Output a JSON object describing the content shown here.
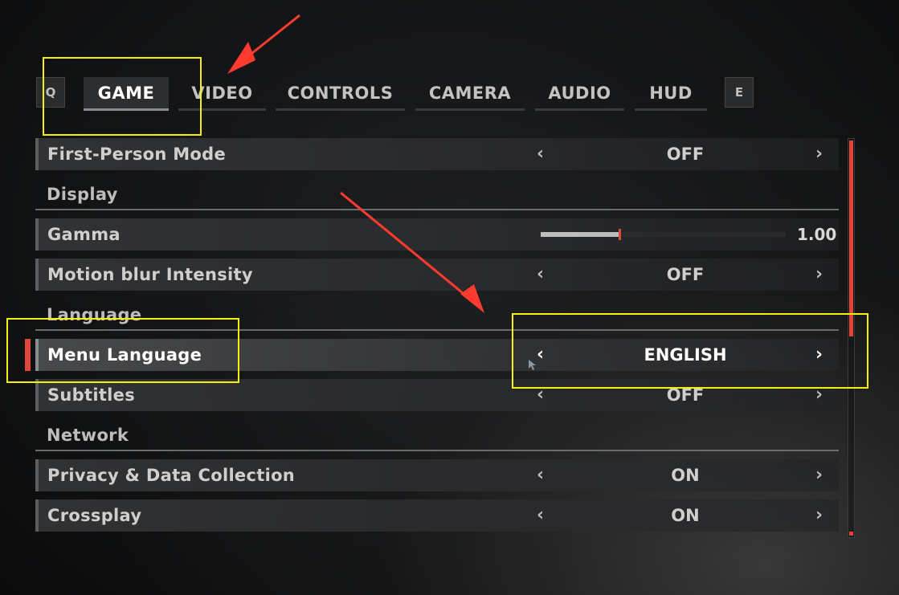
{
  "tabs": {
    "prev_key": "Q",
    "next_key": "E",
    "items": [
      {
        "label": "GAME"
      },
      {
        "label": "VIDEO"
      },
      {
        "label": "CONTROLS"
      },
      {
        "label": "CAMERA"
      },
      {
        "label": "AUDIO"
      },
      {
        "label": "HUD"
      }
    ]
  },
  "settings": {
    "first_person": {
      "label": "First-Person Mode",
      "value": "OFF"
    },
    "display_section": "Display",
    "gamma": {
      "label": "Gamma",
      "value": "1.00",
      "level": 0.32
    },
    "motion_blur": {
      "label": "Motion blur Intensity",
      "value": "OFF"
    },
    "language_section": "Language",
    "menu_language": {
      "label": "Menu Language",
      "value": "ENGLISH"
    },
    "subtitles": {
      "label": "Subtitles",
      "value": "OFF"
    },
    "network_section": "Network",
    "privacy": {
      "label": "Privacy & Data Collection",
      "value": "ON"
    },
    "crossplay": {
      "label": "Crossplay",
      "value": "ON"
    }
  },
  "arrows": {
    "left": "‹",
    "right": "›"
  },
  "colors": {
    "accent": "#e24535",
    "annotation": "#f6f00f",
    "annotation_arrow": "#ff3b30"
  }
}
